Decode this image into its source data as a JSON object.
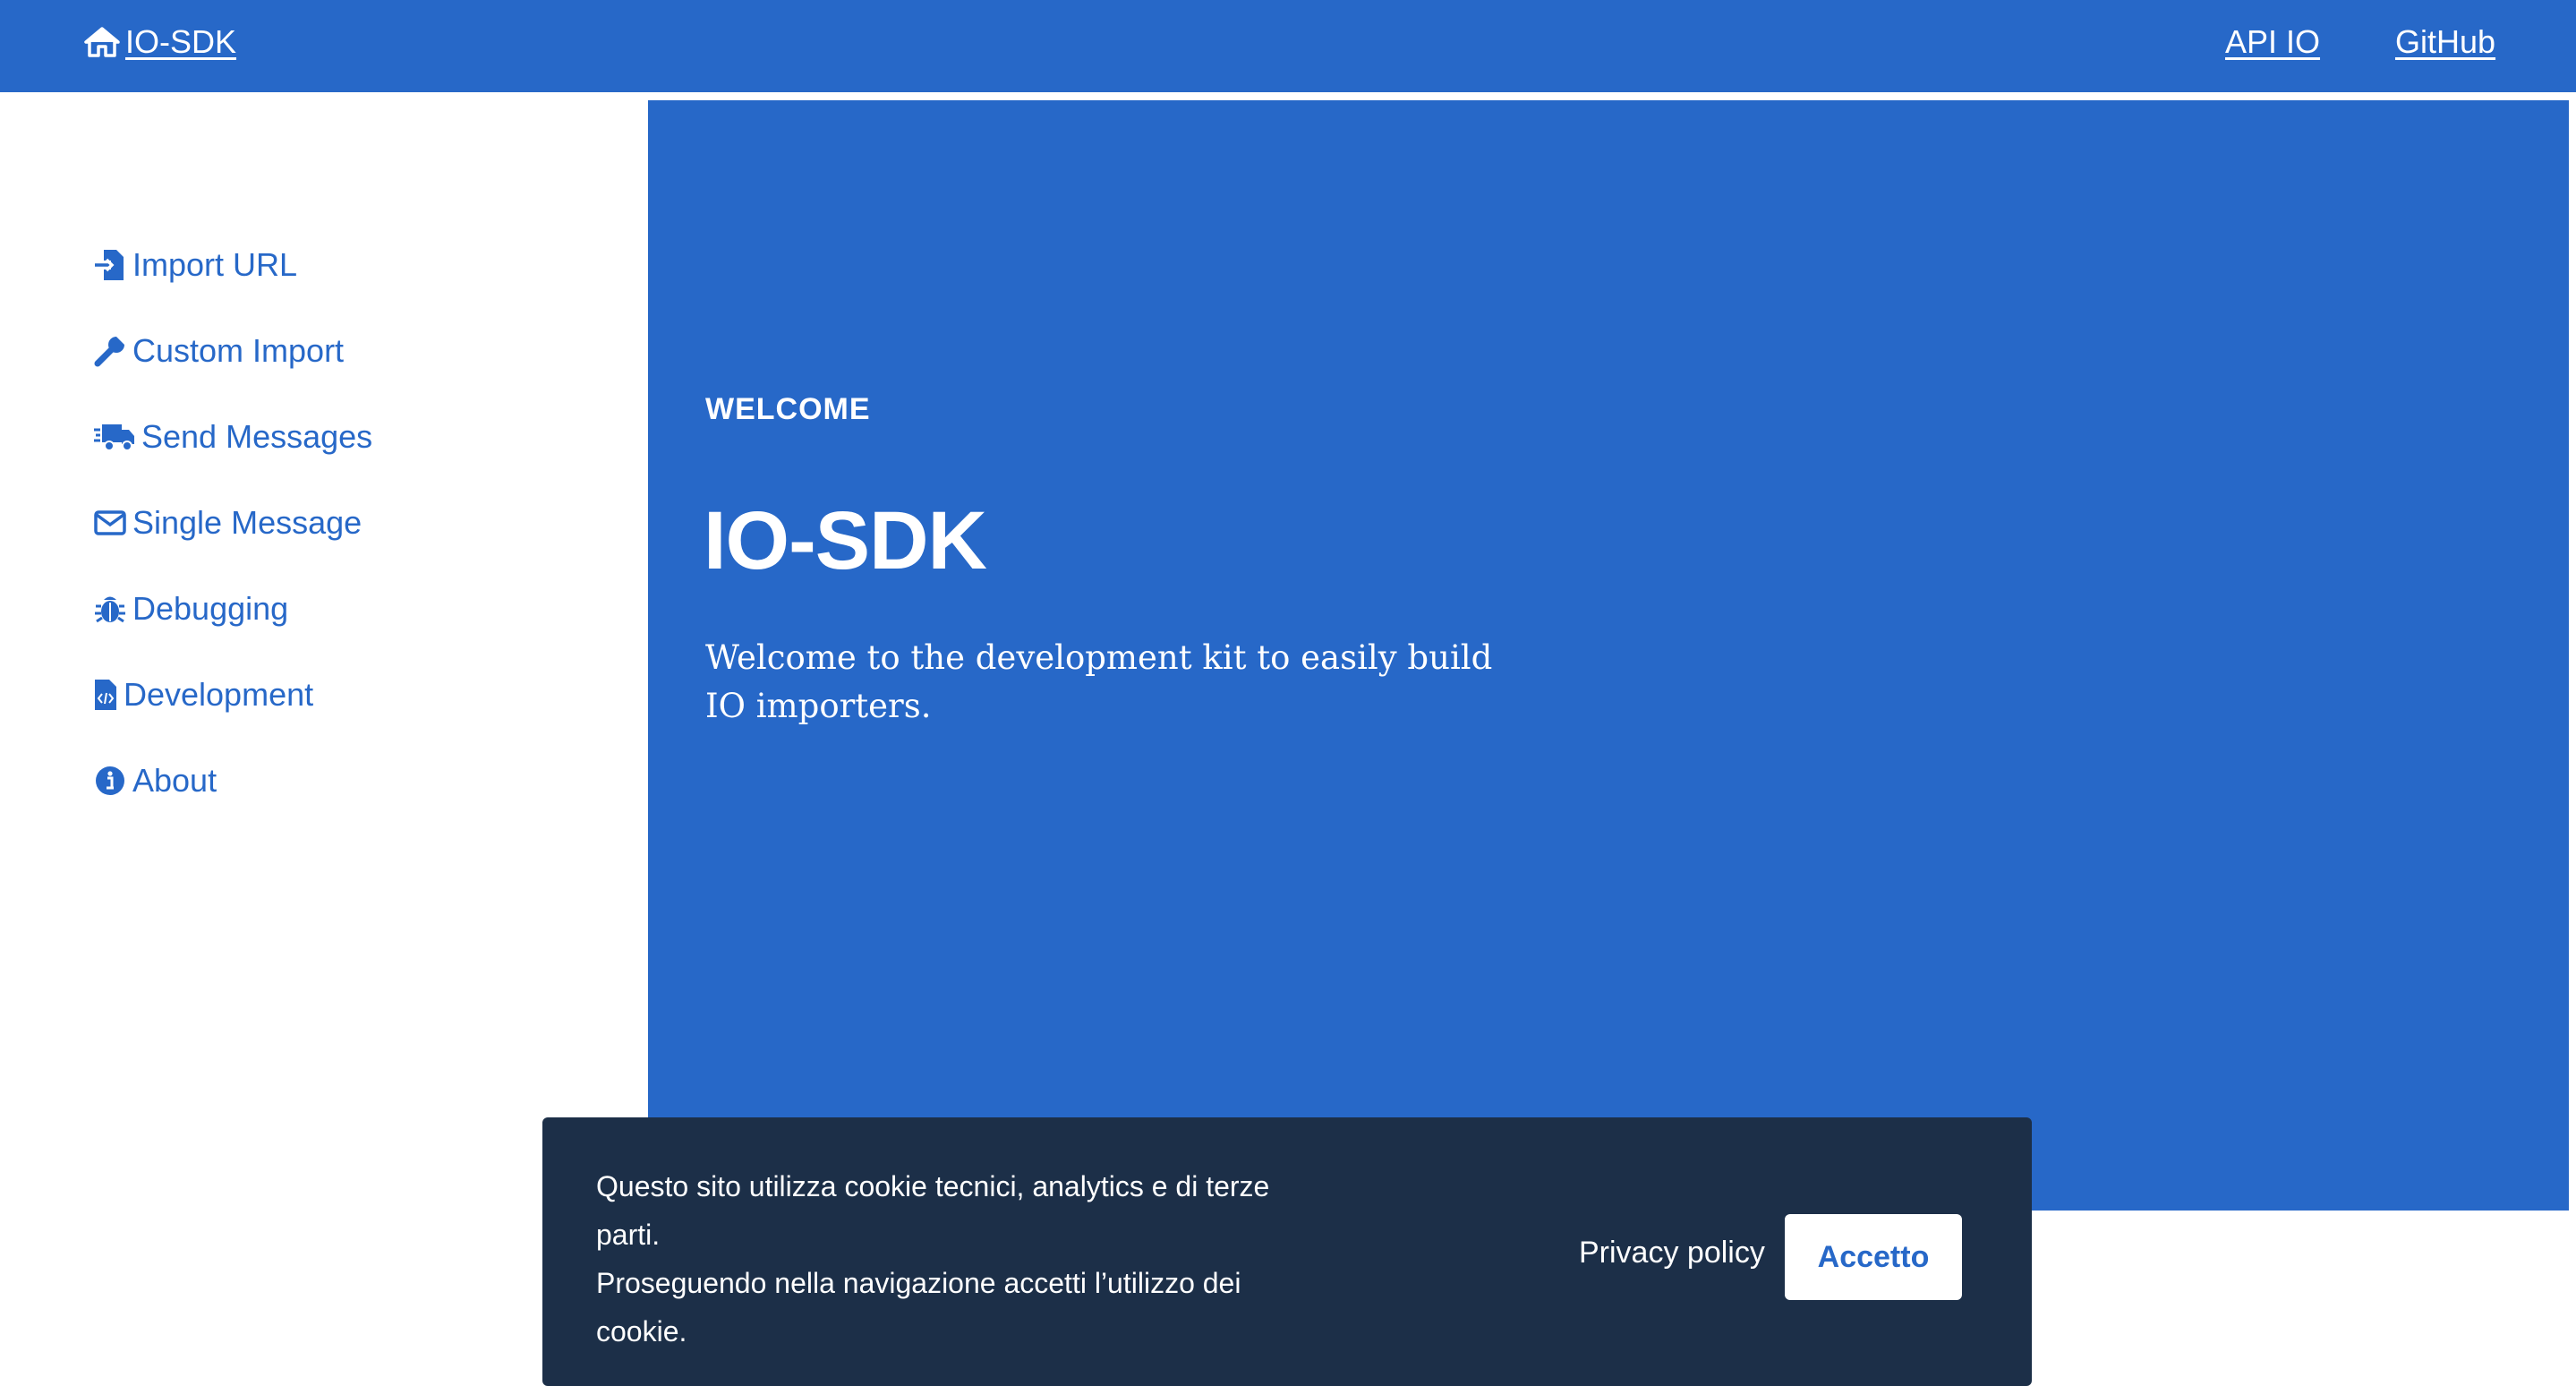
{
  "header": {
    "brand_label": "IO-SDK",
    "brand_icon": "home-icon",
    "links": [
      {
        "label": "API IO"
      },
      {
        "label": "GitHub"
      }
    ]
  },
  "sidebar": {
    "items": [
      {
        "label": "Import URL",
        "icon": "file-import-icon"
      },
      {
        "label": "Custom Import",
        "icon": "wrench-icon"
      },
      {
        "label": "Send Messages",
        "icon": "shipping-fast-icon"
      },
      {
        "label": "Single Message",
        "icon": "envelope-icon"
      },
      {
        "label": "Debugging",
        "icon": "bug-icon"
      },
      {
        "label": "Development",
        "icon": "file-code-icon"
      },
      {
        "label": "About",
        "icon": "info-circle-icon"
      }
    ]
  },
  "hero": {
    "eyebrow": "WELCOME",
    "title": "IO-SDK",
    "lead": "Welcome to the development kit to easily build IO importers."
  },
  "cookie_banner": {
    "line1": "Questo sito utilizza cookie tecnici, analytics e di terze parti.",
    "line2": "Proseguendo nella navigazione accetti l’utilizzo dei cookie.",
    "privacy_label": "Privacy policy",
    "accept_label": "Accetto"
  },
  "colors": {
    "primary": "#2768c8",
    "banner_bg": "#1c2f48",
    "white": "#ffffff"
  }
}
